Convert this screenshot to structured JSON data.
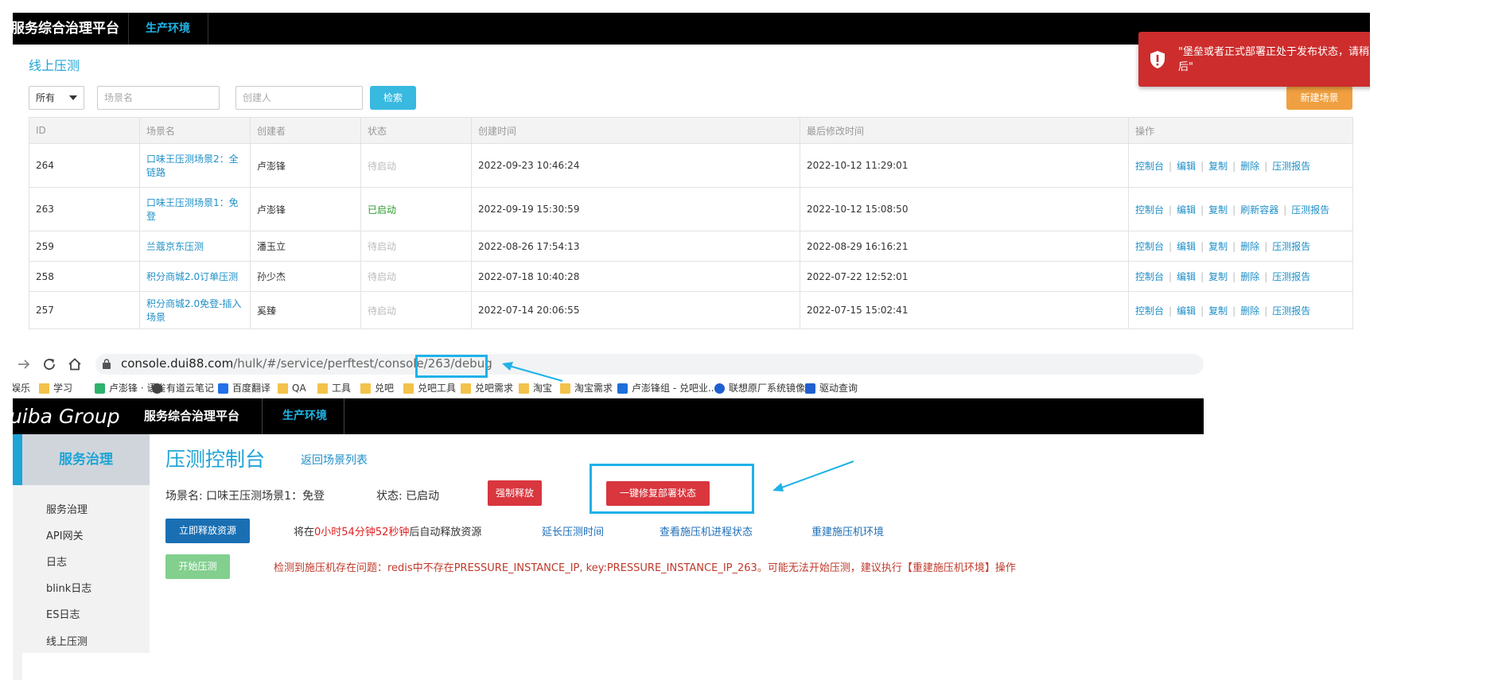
{
  "top": {
    "brand": "服务综合治理平台",
    "env": "生产环境",
    "page_title": "线上压测",
    "filter": {
      "select_value": "所有",
      "scene_placeholder": "场景名",
      "creator_placeholder": "创建人",
      "search_label": "检索",
      "new_label": "新建场景"
    },
    "table": {
      "headers": [
        "ID",
        "场景名",
        "创建者",
        "状态",
        "创建时间",
        "最后修改时间",
        "操作"
      ],
      "rows": [
        {
          "id": "264",
          "name": "口味王压测场景2：全链路",
          "creator": "卢澎锋",
          "status": "待启动",
          "created": "2022-09-23 10:46:24",
          "modified": "2022-10-12 11:29:01",
          "ops": [
            "控制台",
            "编辑",
            "复制",
            "删除",
            "压测报告"
          ]
        },
        {
          "id": "263",
          "name": "口味王压测场景1：免登",
          "creator": "卢澎锋",
          "status": "已启动",
          "created": "2022-09-19 15:30:59",
          "modified": "2022-10-12 15:08:50",
          "ops": [
            "控制台",
            "编辑",
            "复制",
            "刷新容器",
            "压测报告"
          ]
        },
        {
          "id": "259",
          "name": "兰蔻京东压测",
          "creator": "潘玉立",
          "status": "待启动",
          "created": "2022-08-26 17:54:13",
          "modified": "2022-08-29 16:16:21",
          "ops": [
            "控制台",
            "编辑",
            "复制",
            "删除",
            "压测报告"
          ]
        },
        {
          "id": "258",
          "name": "积分商城2.0订单压测",
          "creator": "孙少杰",
          "status": "待启动",
          "created": "2022-07-18 10:40:28",
          "modified": "2022-07-22 12:52:01",
          "ops": [
            "控制台",
            "编辑",
            "复制",
            "删除",
            "压测报告"
          ]
        },
        {
          "id": "257",
          "name": "积分商城2.0免登-插入场景",
          "creator": "奚臻",
          "status": "待启动",
          "created": "2022-07-14 20:06:55",
          "modified": "2022-07-15 15:02:41",
          "ops": [
            "控制台",
            "编辑",
            "复制",
            "删除",
            "压测报告"
          ]
        }
      ]
    },
    "toast": {
      "message": "\"堡垒或者正式部署正处于发布状态，请稍后\"",
      "color": "#cd2d2d"
    }
  },
  "browser": {
    "url_host": "console.dui88.com",
    "url_path": "/hulk/#/service/perftest/console/263/debug",
    "bookmarks": [
      {
        "label": "娱乐",
        "icon": "none"
      },
      {
        "label": "学习",
        "icon": "folder-icon"
      },
      {
        "label": "卢澎锋 · 语雀",
        "icon": "yuque-icon"
      },
      {
        "label": "有道云笔记",
        "icon": "youdao-icon"
      },
      {
        "label": "百度翻译",
        "icon": "baidu-translate-icon"
      },
      {
        "label": "QA",
        "icon": "folder-icon"
      },
      {
        "label": "工具",
        "icon": "folder-icon"
      },
      {
        "label": "兑吧",
        "icon": "folder-icon"
      },
      {
        "label": "兑吧工具",
        "icon": "folder-icon"
      },
      {
        "label": "兑吧需求",
        "icon": "folder-icon"
      },
      {
        "label": "淘宝",
        "icon": "folder-icon"
      },
      {
        "label": "淘宝需求",
        "icon": "folder-icon"
      },
      {
        "label": "卢澎锋组 - 兑吧业...",
        "icon": "confluence-icon"
      },
      {
        "label": "联想原厂系统镜像",
        "icon": "lenovo-icon"
      },
      {
        "label": "驱动查询",
        "icon": "driver-icon"
      }
    ]
  },
  "bottom": {
    "logo": "uiba Group",
    "brand": "服务综合治理平台",
    "env": "生产环境",
    "sidebar": {
      "head": "服务治理",
      "items": [
        "服务治理",
        "API网关",
        "日志",
        "blink日志",
        "ES日志",
        "线上压测"
      ]
    },
    "title": "压测控制台",
    "back": "返回场景列表",
    "scene": "场景名: 口味王压测场景1：免登",
    "status": "状态: 已启动",
    "force_release": "强制释放",
    "fix_deploy": "一键修复部署状态",
    "release_now": "立即释放资源",
    "release_prefix": "将在",
    "release_countdown": "0小时54分钟52秒钟",
    "release_suffix": "后自动释放资源",
    "extend": "延长压测时间",
    "view_process": "查看施压机进程状态",
    "rebuild": "重建施压机环境",
    "start": "开始压测",
    "warning": "检测到施压机存在问题：redis中不存在PRESSURE_INSTANCE_IP, key:PRESSURE_INSTANCE_IP_263。可能无法开始压测，建议执行【重建施压机环境】操作"
  },
  "accent_color": "#1fb2e8"
}
